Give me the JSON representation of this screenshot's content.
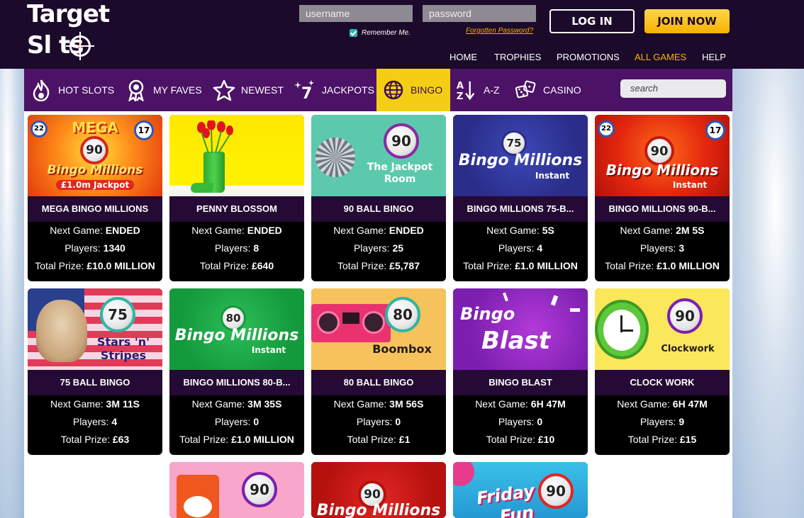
{
  "brand": {
    "line1": "Target",
    "line2": "Sl  ts"
  },
  "login": {
    "username_placeholder": "username",
    "password_placeholder": "password",
    "remember_label": "Remember Me.",
    "forgot_label": "Forgotten Password?",
    "login_label": "LOG IN",
    "join_label": "JOIN NOW"
  },
  "topnav": [
    {
      "label": "HOME"
    },
    {
      "label": "TROPHIES"
    },
    {
      "label": "PROMOTIONS"
    },
    {
      "label": "ALL GAMES",
      "active": true
    },
    {
      "label": "HELP"
    }
  ],
  "categories": [
    {
      "label": "HOT SLOTS",
      "icon": "flame-icon"
    },
    {
      "label": "MY FAVES",
      "icon": "rosette-icon"
    },
    {
      "label": "NEWEST",
      "icon": "star-icon"
    },
    {
      "label": "JACKPOTS",
      "icon": "sparkle-seven-icon"
    },
    {
      "label": "BINGO",
      "icon": "globe-ball-icon",
      "active": true
    },
    {
      "label": "A-Z",
      "icon": "az-sort-icon"
    },
    {
      "label": "CASINO",
      "icon": "dice-icon"
    }
  ],
  "search": {
    "placeholder": "search"
  },
  "labels": {
    "next_game": "Next Game:",
    "players": "Players:",
    "total_prize": "Total Prize:"
  },
  "games": [
    {
      "title": "MEGA BINGO MILLIONS",
      "next_game": "ENDED",
      "players": "1340",
      "total_prize": "£10.0 MILLION",
      "art": {
        "ball": "90",
        "text": "Bingo Millions",
        "subtext": "£1.0m Jackpot",
        "top": "MEGA"
      }
    },
    {
      "title": "PENNY BLOSSOM",
      "next_game": "ENDED",
      "players": "8",
      "total_prize": "£640",
      "art": {}
    },
    {
      "title": "90 BALL BINGO",
      "next_game": "ENDED",
      "players": "25",
      "total_prize": "£5,787",
      "art": {
        "ball": "90",
        "text": "The Jackpot",
        "subtext": "Room"
      }
    },
    {
      "title": "BINGO MILLIONS 75-B...",
      "next_game": "5S",
      "players": "4",
      "total_prize": "£1.0 MILLION",
      "art": {
        "ball": "75",
        "text": "Bingo Millions",
        "subtext": "Instant"
      }
    },
    {
      "title": "BINGO MILLIONS 90-B...",
      "next_game": "2M 5S",
      "players": "3",
      "total_prize": "£1.0 MILLION",
      "art": {
        "ball": "90",
        "text": "Bingo Millions",
        "subtext": "Instant"
      }
    },
    {
      "title": "75 BALL BINGO",
      "next_game": "3M 11S",
      "players": "4",
      "total_prize": "£63",
      "art": {
        "ball": "75",
        "text": "Stars 'n'",
        "subtext": "Stripes"
      }
    },
    {
      "title": "BINGO MILLIONS 80-B...",
      "next_game": "3M 35S",
      "players": "0",
      "total_prize": "£1.0 MILLION",
      "art": {
        "ball": "80",
        "text": "Bingo Millions",
        "subtext": "Instant"
      }
    },
    {
      "title": "80 BALL BINGO",
      "next_game": "3M 56S",
      "players": "0",
      "total_prize": "£1",
      "art": {
        "ball": "80",
        "text": "Boombox"
      }
    },
    {
      "title": "BINGO BLAST",
      "next_game": "6H 47M",
      "players": "0",
      "total_prize": "£10",
      "art": {
        "text": "Bingo",
        "subtext": "Blast"
      }
    },
    {
      "title": "CLOCK WORK",
      "next_game": "6H 47M",
      "players": "9",
      "total_prize": "£15",
      "art": {
        "ball": "90",
        "text": "Clockwork"
      }
    }
  ],
  "partial_games": [
    {
      "art": {
        "ball": "90"
      }
    },
    {
      "art": {
        "ball": "90",
        "text": "Bingo Millions"
      }
    },
    {
      "art": {
        "ball": "90",
        "text": "Friday",
        "subtext": "Fun"
      }
    }
  ]
}
